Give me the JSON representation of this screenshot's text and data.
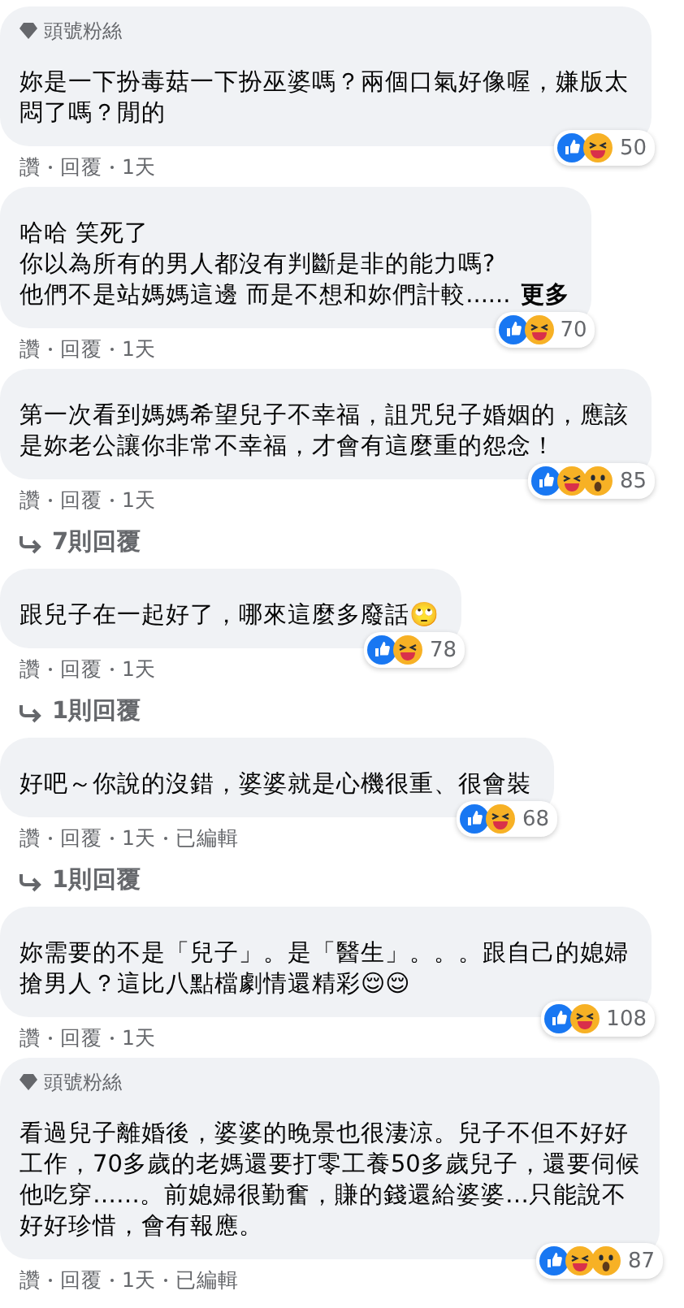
{
  "comments": [
    {
      "badge": "頭號粉絲",
      "lines": [
        "妳是一下扮毒菇一下扮巫婆嗎？兩個口氣好像喔，嫌版太",
        "悶了嗎？閒的"
      ],
      "reactions": [
        {
          "kind": "like"
        },
        {
          "kind": "haha"
        }
      ],
      "reaction_count": "50",
      "actions": [
        "讚",
        "回覆",
        "1天"
      ]
    },
    {
      "lines": [
        "哈哈 笑死了",
        "你以為所有的男人都沒有判斷是非的能力嗎?",
        "他們不是站媽媽這邊 而是不想和妳們計較......"
      ],
      "more": "更多",
      "reactions": [
        {
          "kind": "like"
        },
        {
          "kind": "haha"
        }
      ],
      "reaction_count": "70",
      "actions": [
        "讚",
        "回覆",
        "1天"
      ]
    },
    {
      "lines": [
        "第一次看到媽媽希望兒子不幸福，詛咒兒子婚姻的，應該",
        "是妳老公讓你非常不幸福，才會有這麼重的怨念！"
      ],
      "reactions": [
        {
          "kind": "like"
        },
        {
          "kind": "haha"
        },
        {
          "kind": "wow"
        }
      ],
      "reaction_count": "85",
      "actions": [
        "讚",
        "回覆",
        "1天"
      ],
      "replies": "7則回覆"
    },
    {
      "lines": [
        "跟兒子在一起好了，哪來這麼多廢話🙄"
      ],
      "reactions": [
        {
          "kind": "like"
        },
        {
          "kind": "haha"
        }
      ],
      "reaction_count": "78",
      "actions": [
        "讚",
        "回覆",
        "1天"
      ],
      "replies": "1則回覆"
    },
    {
      "lines": [
        "好吧～你說的沒錯，婆婆就是心機很重、很會裝"
      ],
      "reactions": [
        {
          "kind": "like"
        },
        {
          "kind": "haha"
        }
      ],
      "reaction_count": "68",
      "actions": [
        "讚",
        "回覆",
        "1天",
        "已編輯"
      ],
      "replies": "1則回覆"
    },
    {
      "lines": [
        "妳需要的不是「兒子」。是「醫生」。。。跟自己的媳婦",
        "搶男人？這比八點檔劇情還精彩😌😌"
      ],
      "reactions": [
        {
          "kind": "like"
        },
        {
          "kind": "haha"
        }
      ],
      "reaction_count": "108",
      "actions": [
        "讚",
        "回覆",
        "1天"
      ]
    },
    {
      "badge": "頭號粉絲",
      "lines": [
        "看過兒子離婚後，婆婆的晚景也很淒涼。兒子不但不好好",
        "工作，70多歲的老媽還要打零工養50多歲兒子，還要伺候",
        "他吃穿……。前媳婦很勤奮，賺的錢還給婆婆…只能說不",
        "好好珍惜，會有報應。"
      ],
      "reactions": [
        {
          "kind": "like"
        },
        {
          "kind": "haha"
        },
        {
          "kind": "wow"
        }
      ],
      "reaction_count": "87",
      "actions": [
        "讚",
        "回覆",
        "1天",
        "已編輯"
      ]
    }
  ]
}
